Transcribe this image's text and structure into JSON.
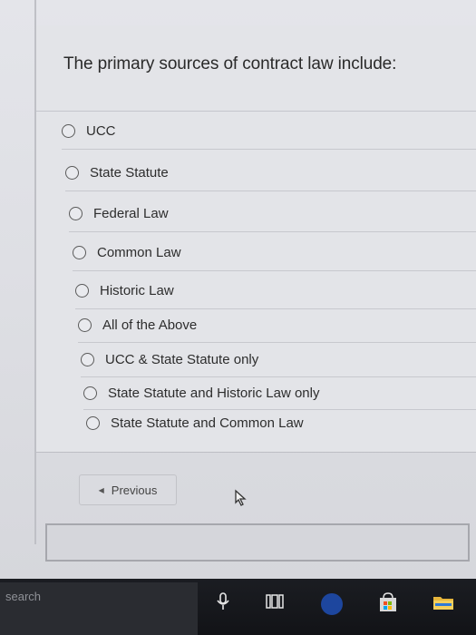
{
  "quiz": {
    "question": "The primary sources of contract law include:",
    "options": [
      {
        "label": "UCC",
        "selected": false
      },
      {
        "label": "State Statute",
        "selected": false
      },
      {
        "label": "Federal Law",
        "selected": false
      },
      {
        "label": "Common Law",
        "selected": false
      },
      {
        "label": "Historic Law",
        "selected": false
      },
      {
        "label": "All of the Above",
        "selected": false
      },
      {
        "label": "UCC & State Statute only",
        "selected": false
      },
      {
        "label": "State Statute and Historic Law only",
        "selected": false
      },
      {
        "label": "State Statute and Common Law",
        "selected": false
      }
    ],
    "previous_label": "Previous"
  },
  "taskbar": {
    "search_placeholder": "search",
    "icons": [
      "microphone-icon",
      "task-view-icon",
      "app-icon",
      "store-icon",
      "file-explorer-icon"
    ]
  }
}
